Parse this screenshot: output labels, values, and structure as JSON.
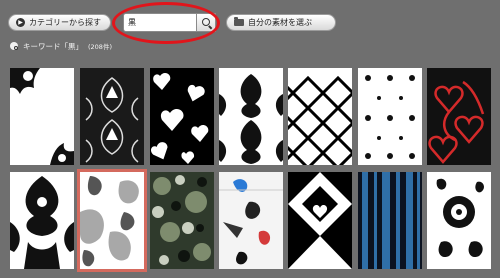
{
  "toolbar": {
    "category_button_label": "カテゴリーから探す",
    "search_value": "黒",
    "own_material_button_label": "自分の素材を選ぶ"
  },
  "keyword": {
    "label": "キーワード「黒」",
    "count": "(208件)"
  },
  "colors": {
    "background": "#6f6f6f",
    "highlight_circle": "#e1151b",
    "selected_outline": "#d46a5e"
  },
  "results": [
    {
      "pattern": "white-black-floral-corner"
    },
    {
      "pattern": "black-white-damask-fleur"
    },
    {
      "pattern": "black-white-hearts"
    },
    {
      "pattern": "white-black-damask"
    },
    {
      "pattern": "black-lattice"
    },
    {
      "pattern": "white-black-dots"
    },
    {
      "pattern": "black-red-hearts"
    },
    {
      "pattern": "white-black-damask-large"
    },
    {
      "pattern": "gray-leaves",
      "selected": true
    },
    {
      "pattern": "green-camouflage"
    },
    {
      "pattern": "white-splash"
    },
    {
      "pattern": "black-white-geometric"
    },
    {
      "pattern": "blue-black-stripes"
    },
    {
      "pattern": "white-black-folk-floral"
    }
  ]
}
